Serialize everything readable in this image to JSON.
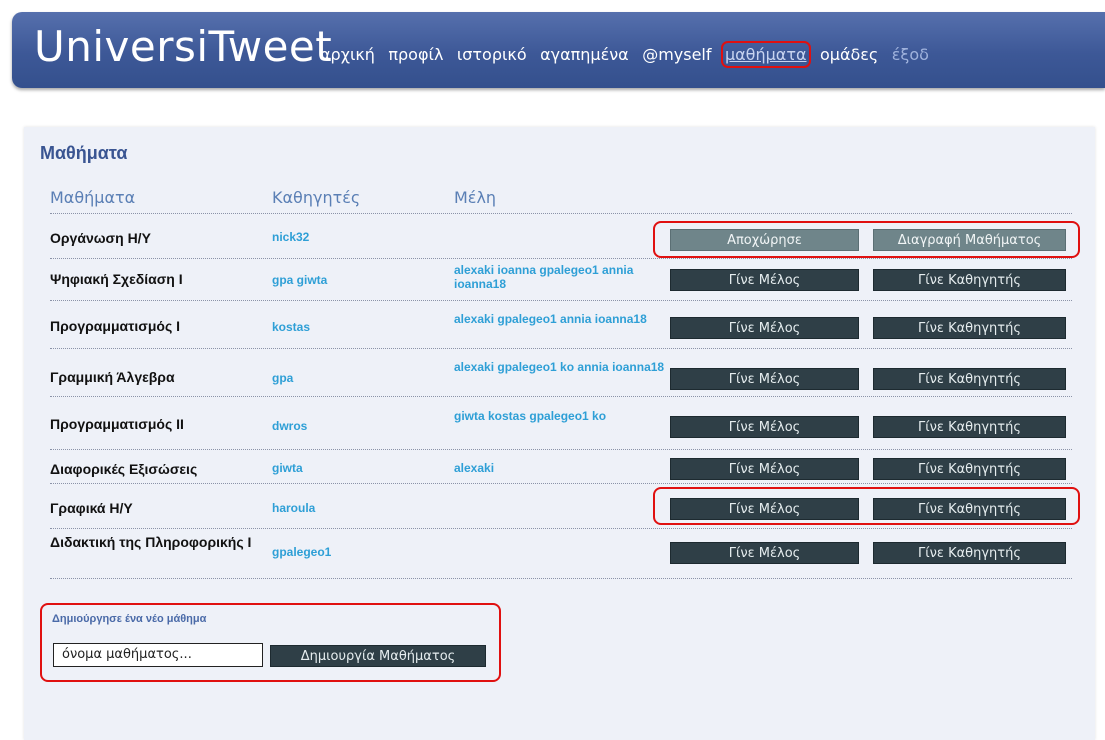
{
  "header": {
    "brand": "UniversiTweet",
    "nav": {
      "home": "αρχική",
      "profile": "προφίλ",
      "history": "ιστορικό",
      "favorites": "αγαπημένα",
      "myself": "@myself",
      "courses": "μαθήματα",
      "groups": "ομάδες",
      "logout": "έξοδ"
    }
  },
  "page": {
    "title": "Μαθήματα",
    "columns": {
      "course": "Μαθήματα",
      "professors": "Καθηγητές",
      "members": "Μέλη"
    }
  },
  "rows": [
    {
      "course": "Οργάνωση Η/Υ",
      "professors": "nick32",
      "members": "",
      "btn1": "Αποχώρησε",
      "btn2": "Διαγραφή Μαθήματος"
    },
    {
      "course": "Ψηφιακή Σχεδίαση Ι",
      "professors": "gpa giwta",
      "members": "alexaki ioanna gpalegeo1 annia ioanna18",
      "btn1": "Γίνε Μέλος",
      "btn2": "Γίνε Καθηγητής"
    },
    {
      "course": "Προγραμματισμός Ι",
      "professors": "kostas",
      "members": "alexaki gpalegeo1 annia ioanna18",
      "btn1": "Γίνε Μέλος",
      "btn2": "Γίνε Καθηγητής"
    },
    {
      "course": "Γραμμική Άλγεβρα",
      "professors": "gpa",
      "members": "alexaki gpalegeo1 ko annia ioanna18",
      "btn1": "Γίνε Μέλος",
      "btn2": "Γίνε Καθηγητής"
    },
    {
      "course": "Προγραμματισμός ΙΙ",
      "professors": "dwros",
      "members": "giwta kostas gpalegeo1 ko",
      "btn1": "Γίνε Μέλος",
      "btn2": "Γίνε Καθηγητής"
    },
    {
      "course": "Διαφορικές Εξισώσεις",
      "professors": "giwta",
      "members": "alexaki",
      "btn1": "Γίνε Μέλος",
      "btn2": "Γίνε Καθηγητής"
    },
    {
      "course": "Γραφικά Η/Υ",
      "professors": "haroula",
      "members": "",
      "btn1": "Γίνε Μέλος",
      "btn2": "Γίνε Καθηγητής"
    },
    {
      "course": "Διδακτική της Πληροφορικής Ι",
      "professors": "gpalegeo1",
      "members": "",
      "btn1": "Γίνε Μέλος",
      "btn2": "Γίνε Καθηγητής"
    }
  ],
  "new_course": {
    "label": "Δημιούργησε ένα νέο μάθημα",
    "placeholder": "όνομα μαθήματος...",
    "button": "Δημιουργία Μαθήματος"
  },
  "colors": {
    "header": "#3d5897",
    "button": "#2f3f47",
    "link": "#2e9fd6",
    "highlight": "#e01010"
  }
}
